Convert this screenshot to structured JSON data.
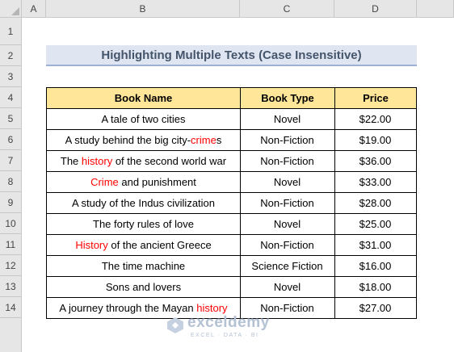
{
  "sheet": {
    "columns": [
      "A",
      "B",
      "C",
      "D"
    ],
    "rows": [
      "1",
      "2",
      "3",
      "4",
      "5",
      "6",
      "7",
      "8",
      "9",
      "10",
      "11",
      "12",
      "13",
      "14"
    ]
  },
  "title": "Highlighting Multiple Texts (Case Insensitive)",
  "table": {
    "headers": [
      "Book Name",
      "Book Type",
      "Price"
    ],
    "rows": [
      {
        "name": [
          {
            "t": "A tale of two cities",
            "hl": false
          }
        ],
        "type": "Novel",
        "price": "$22.00"
      },
      {
        "name": [
          {
            "t": "A study behind the big city-",
            "hl": false
          },
          {
            "t": "crime",
            "hl": true
          },
          {
            "t": "s",
            "hl": false
          }
        ],
        "type": "Non-Fiction",
        "price": "$19.00"
      },
      {
        "name": [
          {
            "t": "The ",
            "hl": false
          },
          {
            "t": "history",
            "hl": true
          },
          {
            "t": " of the second world war",
            "hl": false
          }
        ],
        "type": "Non-Fiction",
        "price": "$36.00"
      },
      {
        "name": [
          {
            "t": "Crime",
            "hl": true
          },
          {
            "t": " and punishment",
            "hl": false
          }
        ],
        "type": "Novel",
        "price": "$33.00"
      },
      {
        "name": [
          {
            "t": "A study of the Indus civilization",
            "hl": false
          }
        ],
        "type": "Non-Fiction",
        "price": "$28.00"
      },
      {
        "name": [
          {
            "t": "The forty rules of love",
            "hl": false
          }
        ],
        "type": "Novel",
        "price": "$25.00"
      },
      {
        "name": [
          {
            "t": "History",
            "hl": true
          },
          {
            "t": " of the ancient Greece",
            "hl": false
          }
        ],
        "type": "Non-Fiction",
        "price": "$31.00"
      },
      {
        "name": [
          {
            "t": "The time machine",
            "hl": false
          }
        ],
        "type": "Science Fiction",
        "price": "$16.00"
      },
      {
        "name": [
          {
            "t": "Sons and lovers",
            "hl": false
          }
        ],
        "type": "Novel",
        "price": "$18.00"
      },
      {
        "name": [
          {
            "t": "A journey through the Mayan ",
            "hl": false
          },
          {
            "t": "history",
            "hl": true
          }
        ],
        "type": "Non-Fiction",
        "price": "$27.00"
      }
    ]
  },
  "watermark": {
    "name": "exceldemy",
    "sub": "EXCEL · DATA · BI"
  },
  "colors": {
    "highlight": "#ff0000",
    "header_fill": "#ffe699",
    "title_fill": "#dfe6f2"
  }
}
